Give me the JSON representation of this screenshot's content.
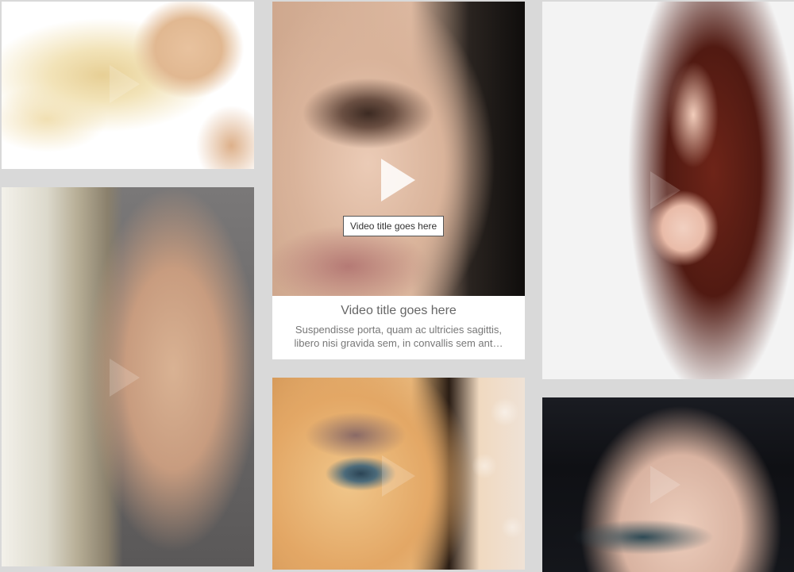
{
  "gallery": {
    "items": [
      {
        "image": "blonde-hair-blowing"
      },
      {
        "image": "platinum-blonde-profile"
      },
      {
        "image": "eye-makeup-closeup",
        "tooltip": "Video title goes here",
        "title": "Video title goes here",
        "description_line1": "Suspendisse porta, quam ac ultricies sagittis,",
        "description_line2": "libero nisi gravida sem, in convallis sem ant…"
      },
      {
        "image": "blue-eye-bokeh"
      },
      {
        "image": "long-auburn-hair"
      },
      {
        "image": "dark-hair-smoky-eyes"
      }
    ]
  },
  "icons": {
    "play": "play-icon"
  },
  "colors": {
    "background": "#d9d9d9",
    "caption_background": "#ffffff",
    "caption_title": "#666666",
    "caption_text": "#777777"
  }
}
